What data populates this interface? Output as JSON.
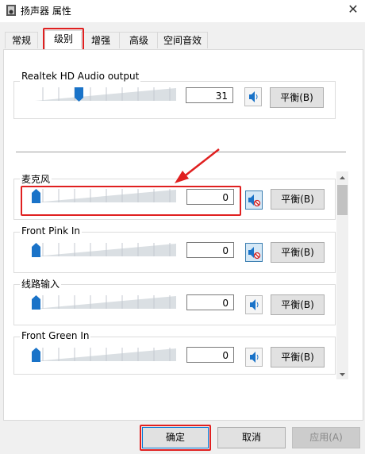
{
  "window": {
    "title": "扬声器 属性",
    "close_label": "✕"
  },
  "tabs": [
    {
      "label": "常规"
    },
    {
      "label": "级别"
    },
    {
      "label": "增强"
    },
    {
      "label": "高级"
    },
    {
      "label": "空间音效"
    }
  ],
  "output": {
    "label": "Realtek HD Audio output",
    "value": "31",
    "level_percent": 31,
    "balance_label": "平衡(B)"
  },
  "inputs": [
    {
      "label": "麦克风",
      "value": "0",
      "muted": true,
      "balance_label": "平衡(B)"
    },
    {
      "label": "Front Pink In",
      "value": "0",
      "muted": true,
      "balance_label": "平衡(B)"
    },
    {
      "label": "线路输入",
      "value": "0",
      "muted": false,
      "balance_label": "平衡(B)"
    },
    {
      "label": "Front Green In",
      "value": "0",
      "muted": false,
      "balance_label": "平衡(B)"
    }
  ],
  "buttons": {
    "ok": "确定",
    "cancel": "取消",
    "apply": "应用(A)"
  },
  "colors": {
    "thumb": "#1a73c8",
    "highlight": "#e02020"
  }
}
